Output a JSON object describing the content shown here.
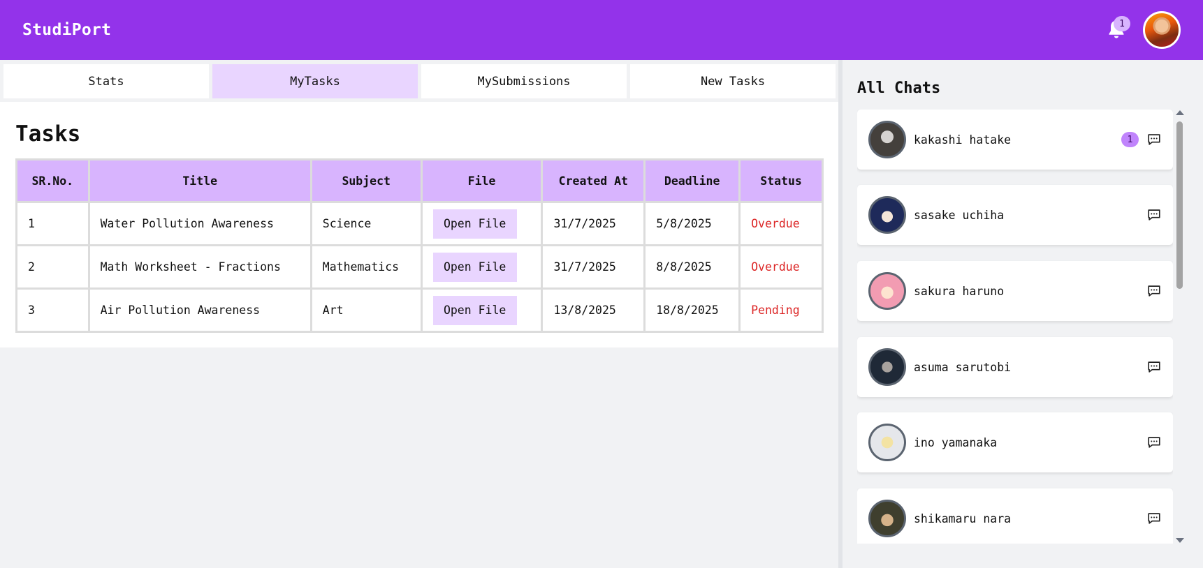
{
  "header": {
    "brand": "StudiPort",
    "notification_count": "1"
  },
  "tabs": [
    {
      "label": "Stats"
    },
    {
      "label": "MyTasks",
      "active": true
    },
    {
      "label": "MySubmissions"
    },
    {
      "label": "New Tasks"
    }
  ],
  "tasks": {
    "title": "Tasks",
    "columns": [
      "SR.No.",
      "Title",
      "Subject",
      "File",
      "Created At",
      "Deadline",
      "Status"
    ],
    "rows": [
      {
        "sr": "1",
        "title": "Water Pollution Awareness",
        "subject": "Science",
        "file": "Open File",
        "created": "31/7/2025",
        "deadline": "5/8/2025",
        "status": "Overdue"
      },
      {
        "sr": "2",
        "title": "Math Worksheet - Fractions",
        "subject": "Mathematics",
        "file": "Open File",
        "created": "31/7/2025",
        "deadline": "8/8/2025",
        "status": "Overdue"
      },
      {
        "sr": "3",
        "title": "Air Pollution Awareness",
        "subject": "Art",
        "file": "Open File",
        "created": "13/8/2025",
        "deadline": "18/8/2025",
        "status": "Pending"
      }
    ]
  },
  "chats": {
    "title": "All Chats",
    "items": [
      {
        "name": "kakashi hatake",
        "unread": "1"
      },
      {
        "name": "sasake uchiha"
      },
      {
        "name": "sakura haruno"
      },
      {
        "name": "asuma sarutobi"
      },
      {
        "name": "ino yamanaka"
      },
      {
        "name": "shikamaru nara"
      }
    ]
  },
  "colors": {
    "brand_purple": "#9333ea",
    "header_purple": "#d8b4fe",
    "active_tab": "#e9d5ff",
    "status_red": "#dc2626"
  },
  "icons": {
    "bell": "bell-icon",
    "message": "chat-bubble-icon"
  }
}
